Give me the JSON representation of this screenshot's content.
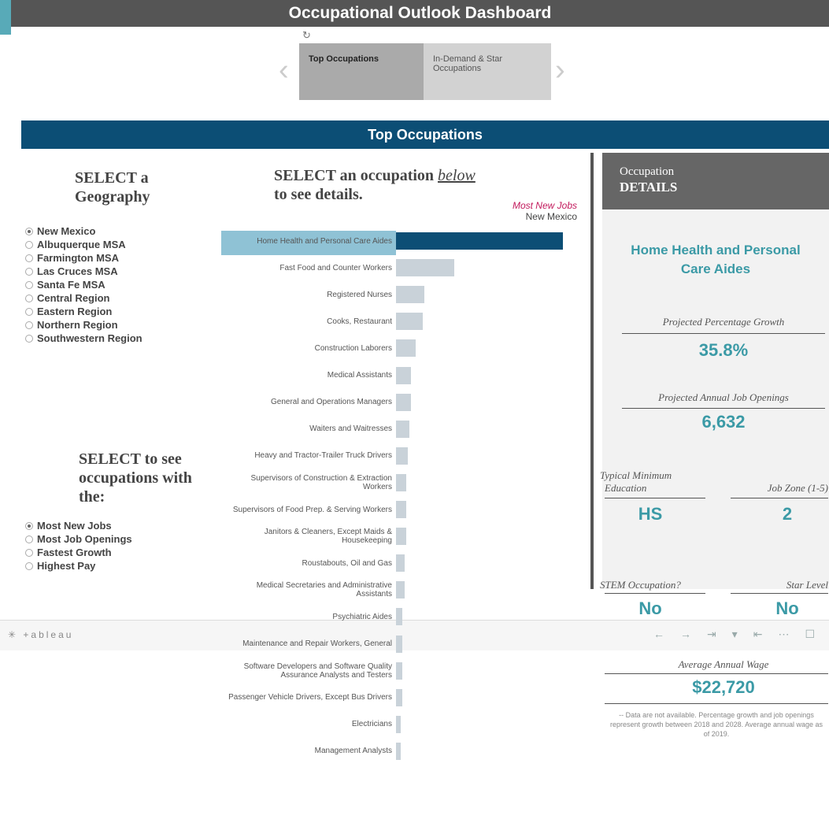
{
  "dashboard": {
    "title": "Occupational Outlook Dashboard"
  },
  "story_tabs": [
    "Top Occupations",
    "In-Demand & Star Occupations"
  ],
  "section": {
    "title": "Top Occupations"
  },
  "geography": {
    "heading_line1": "SELECT a",
    "heading_line2": "Geography",
    "options": [
      "New Mexico",
      "Albuquerque MSA",
      "Farmington MSA",
      "Las Cruces MSA",
      "Santa Fe MSA",
      "Central Region",
      "Eastern Region",
      "Northern Region",
      "Southwestern Region"
    ],
    "selected": 0
  },
  "occupation_select": {
    "line1_pre": "SELECT an occupation ",
    "line1_em": "below",
    "line2": "to see details."
  },
  "measure": {
    "heading_line1": "SELECT to see",
    "heading_line2": "occupations with",
    "heading_line3": "the:",
    "options": [
      "Most New Jobs",
      "Most Job Openings",
      "Fastest Growth",
      "Highest Pay"
    ],
    "selected": 0
  },
  "chart_data": {
    "type": "bar",
    "legend_measure": "Most New Jobs",
    "legend_geo": "New Mexico",
    "selected_index": 0,
    "categories": [
      "Home Health and Personal Care Aides",
      "Fast Food and Counter Workers",
      "Registered Nurses",
      "Cooks, Restaurant",
      "Construction Laborers",
      "Medical Assistants",
      "General and Operations Managers",
      "Waiters and Waitresses",
      "Heavy and Tractor-Trailer Truck Drivers",
      "Supervisors of Construction & Extraction Workers",
      "Supervisors of Food Prep. & Serving Workers",
      "Janitors & Cleaners, Except Maids & Housekeeping",
      "Roustabouts, Oil and Gas",
      "Medical Secretaries and Administrative Assistants",
      "Psychiatric Aides",
      "Maintenance and Repair Workers, General",
      "Software Developers and Software Quality Assurance Analysts and Testers",
      "Passenger Vehicle Drivers, Except Bus Drivers",
      "Electricians",
      "Management Analysts"
    ],
    "values": [
      100,
      35,
      17,
      16,
      12,
      9,
      9,
      8,
      7,
      6,
      6,
      6,
      5,
      5,
      4,
      4,
      4,
      4,
      3,
      3
    ]
  },
  "details": {
    "header_line1": "Occupation",
    "header_line2": "DETAILS",
    "occupation_line1": "Home Health and Personal",
    "occupation_line2": "Care Aides",
    "growth_label": "Projected Percentage Growth",
    "growth_value": "35.8%",
    "openings_label": "Projected Annual Job Openings",
    "openings_value": "6,632",
    "education_label_line1": "Typical Minimum",
    "education_label_line2": "Education",
    "education_value": "HS",
    "jobzone_label": "Job Zone (1-5)",
    "jobzone_value": "2",
    "stem_label": "STEM Occupation?",
    "stem_value": "No",
    "star_label": "Star Level",
    "star_value": "No",
    "wage_label": "Average Annual Wage",
    "wage_value": "$22,720",
    "note": "-- Data are not available. Percentage growth and job openings represent growth between 2018 and 2028. Average annual wage as of 2019."
  },
  "footer": {
    "brand": "+ableau"
  },
  "colors": {
    "navy": "#0c4e75",
    "teal": "#3b9aa6",
    "highlight": "#8fc2d5",
    "bar": "#c9d2d9",
    "legend": "#c2185b"
  }
}
